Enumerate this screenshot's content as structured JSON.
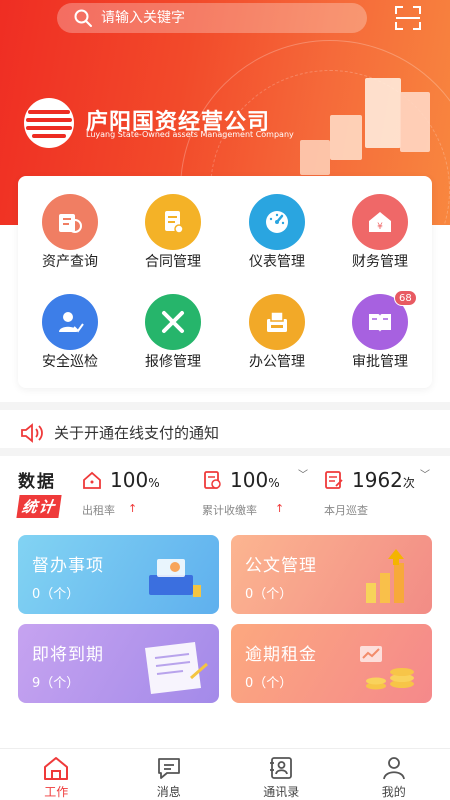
{
  "search": {
    "placeholder": "请输入关键字"
  },
  "company": {
    "name": "庐阳国资经营公司",
    "name_en": "Luyang State-Owned assets Management Company"
  },
  "menu": [
    {
      "label": "资产查询",
      "icon": "asset-icon",
      "color": "#f07e63"
    },
    {
      "label": "合同管理",
      "icon": "contract-icon",
      "color": "#f4b227"
    },
    {
      "label": "仪表管理",
      "icon": "meter-icon",
      "color": "#2aa5e0"
    },
    {
      "label": "财务管理",
      "icon": "finance-icon",
      "color": "#ef6868"
    },
    {
      "label": "安全巡检",
      "icon": "inspection-icon",
      "color": "#3d7ee8"
    },
    {
      "label": "报修管理",
      "icon": "repair-icon",
      "color": "#26b56b"
    },
    {
      "label": "办公管理",
      "icon": "office-icon",
      "color": "#f2a928"
    },
    {
      "label": "审批管理",
      "icon": "approval-icon",
      "color": "#a761e0",
      "badge": "68"
    }
  ],
  "notice": {
    "text": "关于开通在线支付的通知"
  },
  "stats": {
    "title_top": "数据",
    "title_bottom": "统计",
    "items": [
      {
        "value": "100",
        "unit": "%",
        "caption": "出租率",
        "icon": "house-icon"
      },
      {
        "value": "100",
        "unit": "%",
        "caption": "累计收缴率",
        "icon": "receipt-icon"
      },
      {
        "value": "1962",
        "unit": "次",
        "caption": "本月巡查",
        "icon": "checklist-icon"
      }
    ]
  },
  "tiles": [
    {
      "title": "督办事项",
      "count": "0（个）",
      "colors": [
        "#7ed0f2",
        "#63b2ee"
      ]
    },
    {
      "title": "公文管理",
      "count": "0（个）",
      "colors": [
        "#fbb18c",
        "#f38e86"
      ]
    },
    {
      "title": "即将到期",
      "count": "9（个）",
      "colors": [
        "#c3a0ef",
        "#a48ae9"
      ]
    },
    {
      "title": "逾期租金",
      "count": "0（个）",
      "colors": [
        "#fba37d",
        "#f58a8b"
      ]
    }
  ],
  "tabs": [
    {
      "label": "工作",
      "icon": "home-icon",
      "active": true
    },
    {
      "label": "消息",
      "icon": "message-icon",
      "active": false
    },
    {
      "label": "通讯录",
      "icon": "contacts-icon",
      "active": false
    },
    {
      "label": "我的",
      "icon": "profile-icon",
      "active": false
    }
  ],
  "colors": {
    "brand": "#ef3a3a"
  }
}
